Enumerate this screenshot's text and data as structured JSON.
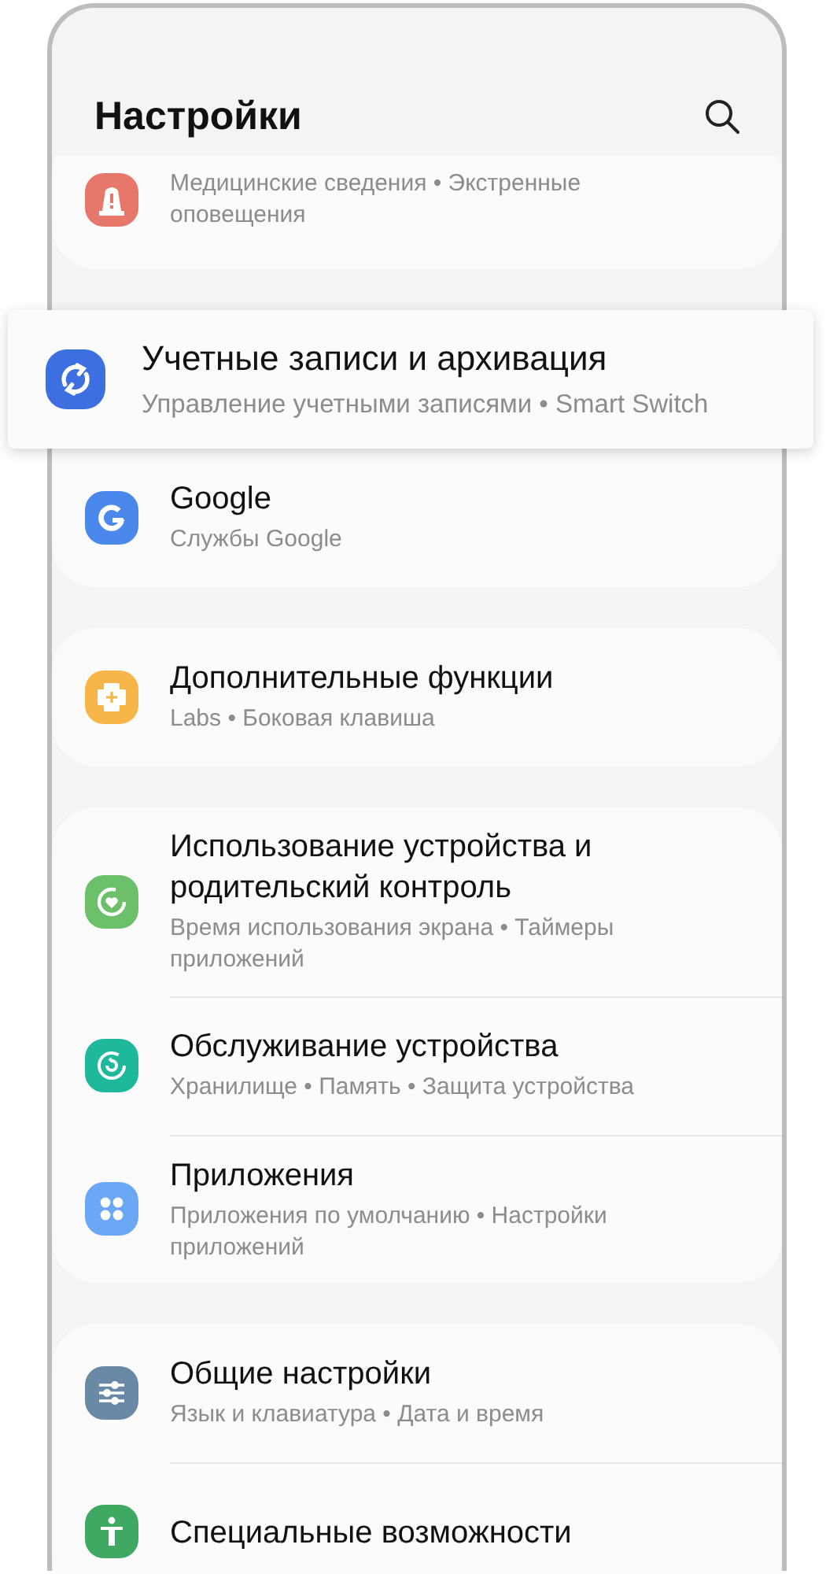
{
  "header": {
    "title": "Настройки"
  },
  "sections": [
    {
      "items": [
        {
          "kind": "alert",
          "color": "#e8776b",
          "subtitle": "Медицинские сведения • Экстренные оповещения",
          "highlighted": false
        }
      ]
    },
    {
      "items": [
        {
          "kind": "sync",
          "color": "#3d6fe0",
          "title": "Учетные записи и архивация",
          "subtitle": "Управление учетными записями • Smart Switch",
          "highlighted": true
        },
        {
          "kind": "google",
          "color": "#4a88ec",
          "title": "Google",
          "subtitle": "Службы Google",
          "highlighted": false
        }
      ]
    },
    {
      "items": [
        {
          "kind": "labs",
          "color": "#f6b547",
          "title": "Дополнительные функции",
          "subtitle": "Labs • Боковая клавиша",
          "highlighted": false
        }
      ]
    },
    {
      "items": [
        {
          "kind": "wellbeing",
          "color": "#6cc06a",
          "title": "Использование устройства и родительский контроль",
          "subtitle": "Время использования экрана • Таймеры приложений",
          "highlighted": false
        },
        {
          "kind": "care",
          "color": "#1eb89c",
          "title": "Обслуживание устройства",
          "subtitle": "Хранилище • Память • Защита устройства",
          "highlighted": false
        },
        {
          "kind": "apps",
          "color": "#6aa8f5",
          "title": "Приложения",
          "subtitle": "Приложения по умолчанию • Настройки приложений",
          "highlighted": false
        }
      ]
    },
    {
      "items": [
        {
          "kind": "general",
          "color": "#6a89a6",
          "title": "Общие настройки",
          "subtitle": "Язык и клавиатура • Дата и время",
          "highlighted": false
        },
        {
          "kind": "accessibility",
          "color": "#3fa862",
          "title": "Специальные возможности",
          "highlighted": false
        }
      ]
    }
  ]
}
